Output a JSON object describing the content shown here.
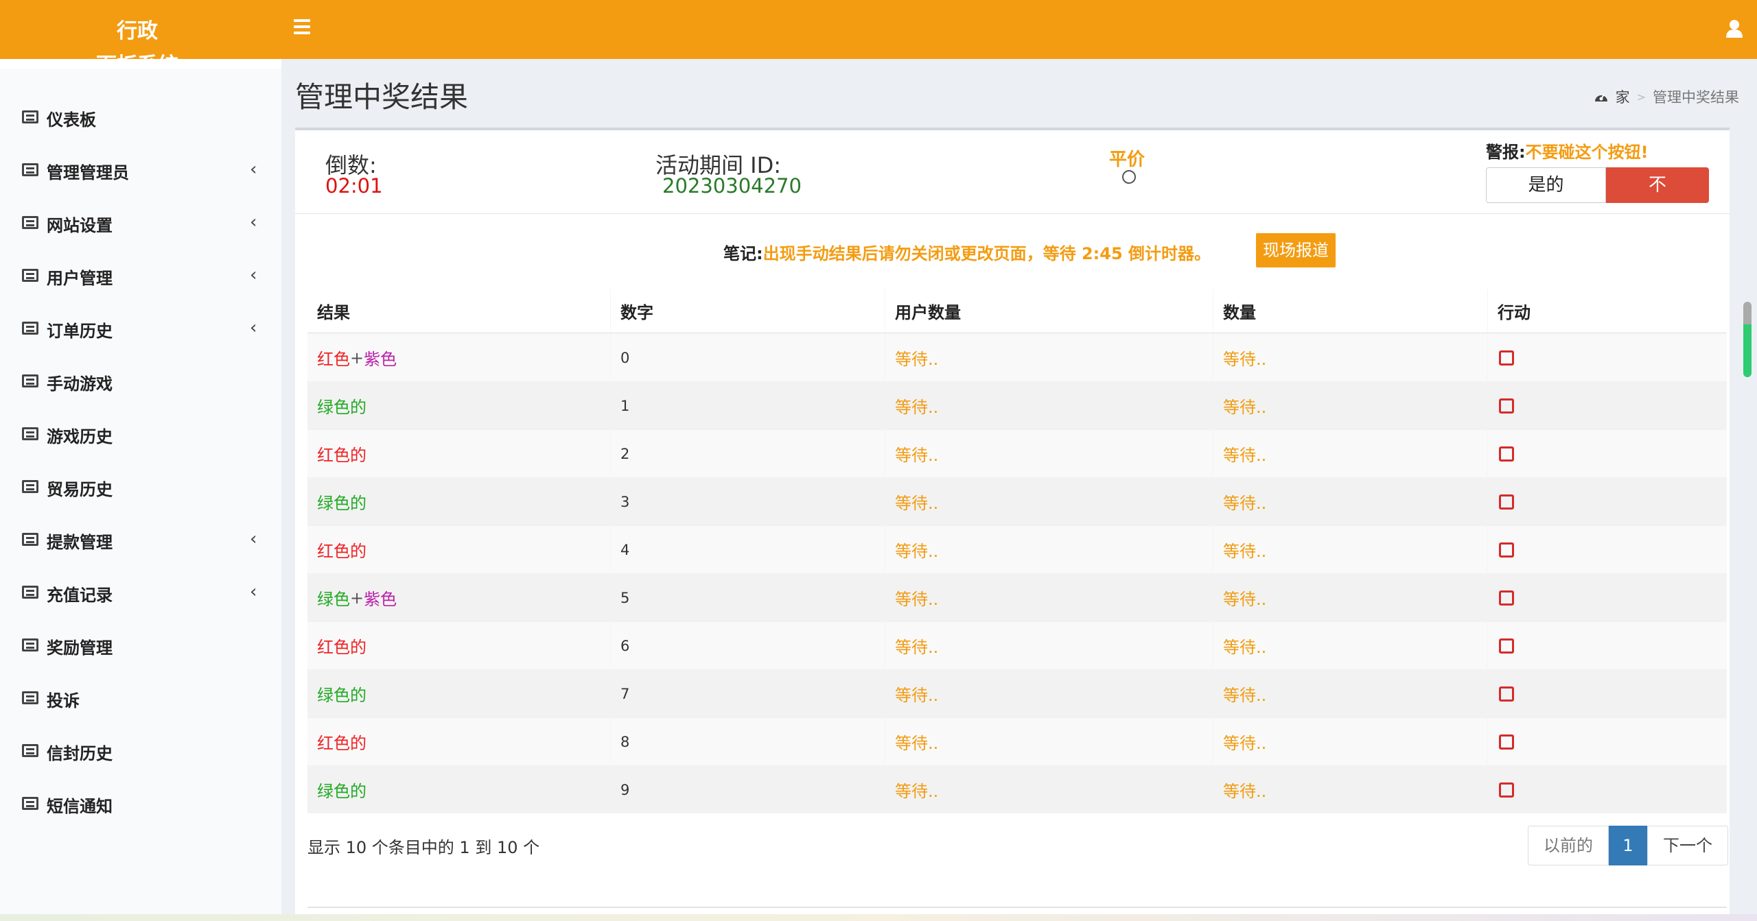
{
  "header": {
    "logo_line1": "行政",
    "logo_line2": "面板系统",
    "accent_color": "#f39c12"
  },
  "sidebar": {
    "items": [
      {
        "label": "仪表板",
        "has_children": false
      },
      {
        "label": "管理管理员",
        "has_children": true
      },
      {
        "label": "网站设置",
        "has_children": true
      },
      {
        "label": "用户管理",
        "has_children": true
      },
      {
        "label": "订单历史",
        "has_children": true
      },
      {
        "label": "手动游戏",
        "has_children": false
      },
      {
        "label": "游戏历史",
        "has_children": false
      },
      {
        "label": "贸易历史",
        "has_children": false
      },
      {
        "label": "提款管理",
        "has_children": true
      },
      {
        "label": "充值记录",
        "has_children": true
      },
      {
        "label": "奖励管理",
        "has_children": false
      },
      {
        "label": "投诉",
        "has_children": false
      },
      {
        "label": "信封历史",
        "has_children": false
      },
      {
        "label": "短信通知",
        "has_children": false
      }
    ],
    "chevron": "‹"
  },
  "page": {
    "title": "管理中奖结果",
    "breadcrumb_home": "家",
    "breadcrumb_sep": ">",
    "breadcrumb_current": "管理中奖结果"
  },
  "status": {
    "countdown_label": "倒数:",
    "countdown_value": "02:01",
    "period_label": "活动期间 ID:",
    "period_value": "20230304270",
    "tie_label": "平价",
    "alert_label": "警报:",
    "alert_text": "不要碰这个按钮!",
    "yes_label": "是的",
    "no_label": "不"
  },
  "note": {
    "label": "笔记:",
    "text": "出现手动结果后请勿关闭或更改页面，等待 2:45 倒计时器。",
    "live_button": "现场报道"
  },
  "table": {
    "headers": [
      "结果",
      "数字",
      "用户数量",
      "数量",
      "行动"
    ],
    "rows": [
      {
        "result": [
          {
            "t": "红色",
            "c": "red"
          },
          {
            "t": "+",
            "c": "plus"
          },
          {
            "t": "紫色",
            "c": "purple"
          }
        ],
        "number": "0",
        "users": "等待..",
        "amount": "等待.."
      },
      {
        "result": [
          {
            "t": "绿色的",
            "c": "green"
          }
        ],
        "number": "1",
        "users": "等待..",
        "amount": "等待.."
      },
      {
        "result": [
          {
            "t": "红色的",
            "c": "red"
          }
        ],
        "number": "2",
        "users": "等待..",
        "amount": "等待.."
      },
      {
        "result": [
          {
            "t": "绿色的",
            "c": "green"
          }
        ],
        "number": "3",
        "users": "等待..",
        "amount": "等待.."
      },
      {
        "result": [
          {
            "t": "红色的",
            "c": "red"
          }
        ],
        "number": "4",
        "users": "等待..",
        "amount": "等待.."
      },
      {
        "result": [
          {
            "t": "绿色",
            "c": "green"
          },
          {
            "t": "+",
            "c": "plus"
          },
          {
            "t": "紫色",
            "c": "purple"
          }
        ],
        "number": "5",
        "users": "等待..",
        "amount": "等待.."
      },
      {
        "result": [
          {
            "t": "红色的",
            "c": "red"
          }
        ],
        "number": "6",
        "users": "等待..",
        "amount": "等待.."
      },
      {
        "result": [
          {
            "t": "绿色的",
            "c": "green"
          }
        ],
        "number": "7",
        "users": "等待..",
        "amount": "等待.."
      },
      {
        "result": [
          {
            "t": "红色的",
            "c": "red"
          }
        ],
        "number": "8",
        "users": "等待..",
        "amount": "等待.."
      },
      {
        "result": [
          {
            "t": "绿色的",
            "c": "green"
          }
        ],
        "number": "9",
        "users": "等待..",
        "amount": "等待.."
      }
    ]
  },
  "pagination": {
    "info": "显示 10 个条目中的 1 到 10 个",
    "prev": "以前的",
    "current": "1",
    "next": "下一个"
  }
}
